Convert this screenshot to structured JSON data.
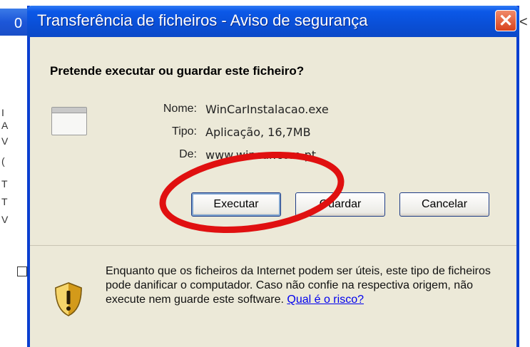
{
  "background": {
    "title_fragment": "0",
    "glyphs": [
      "I",
      "A",
      "V",
      "(",
      "T",
      "T",
      "V"
    ],
    "right_glyph": "<"
  },
  "dialog": {
    "title": "Transferência de ficheiros - Aviso de segurança",
    "close_label": "✕",
    "question": "Pretende executar ou guardar este ficheiro?",
    "file": {
      "name_label": "Nome:",
      "name_value": "WinCarInstalacao.exe",
      "type_label": "Tipo:",
      "type_value": "Aplicação, 16,7MB",
      "from_label": "De:",
      "from_value": "www.wincar.com.pt"
    },
    "buttons": {
      "run": "Executar",
      "save": "Guardar",
      "cancel": "Cancelar"
    },
    "warning": {
      "text": "Enquanto que os ficheiros da Internet podem ser úteis, este tipo de ficheiros pode danificar o computador. Caso não confie na respectiva origem, não execute nem guarde este software.",
      "link": "Qual é o risco?"
    }
  },
  "colors": {
    "titlebar": "#0b58e8",
    "dialog_bg": "#ece9d8",
    "highlight_circle": "#e01010",
    "link": "#0000ee"
  }
}
